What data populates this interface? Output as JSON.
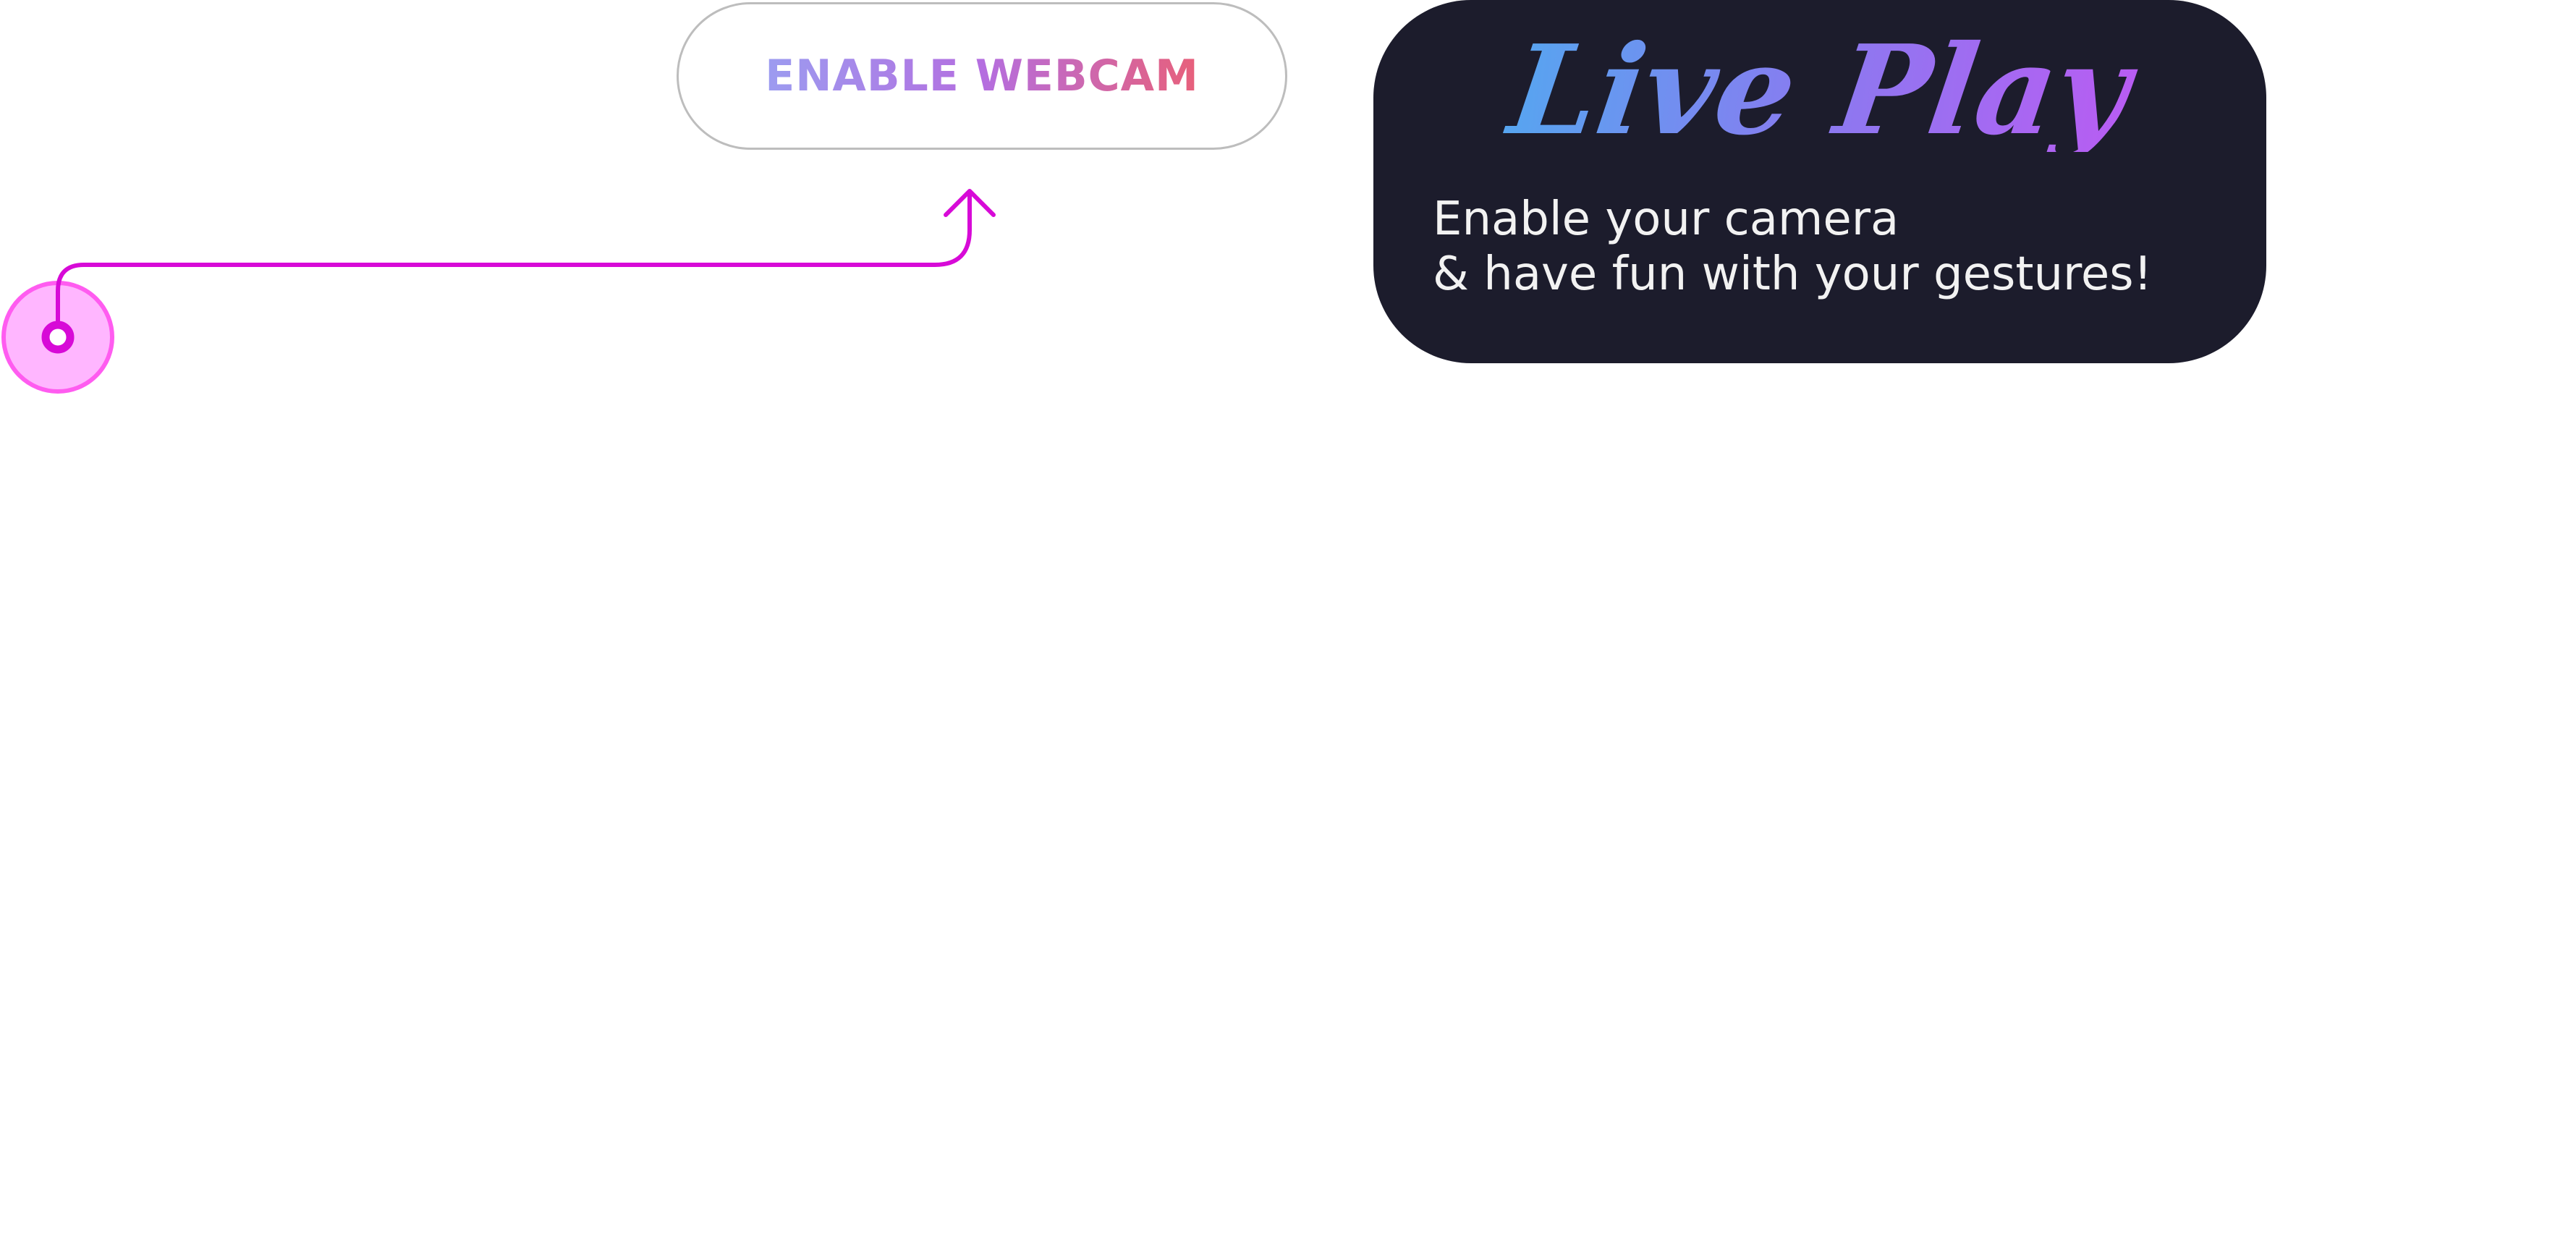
{
  "webcam_button": {
    "label": "ENABLE WEBCAM"
  },
  "info_card": {
    "title": "Live Play",
    "line1": "Enable your camera",
    "line2": "& have fun with your gestures!"
  },
  "colors": {
    "connector": "#d70ad7",
    "cursor_fill": "#ffb6ff",
    "cursor_ring": "#ff5cf0",
    "card_background": "#1c1c2c",
    "button_border": "#bdbdbd"
  },
  "icons": {
    "pointer": "cursor-target-icon",
    "arrow": "arrow-up-icon"
  }
}
